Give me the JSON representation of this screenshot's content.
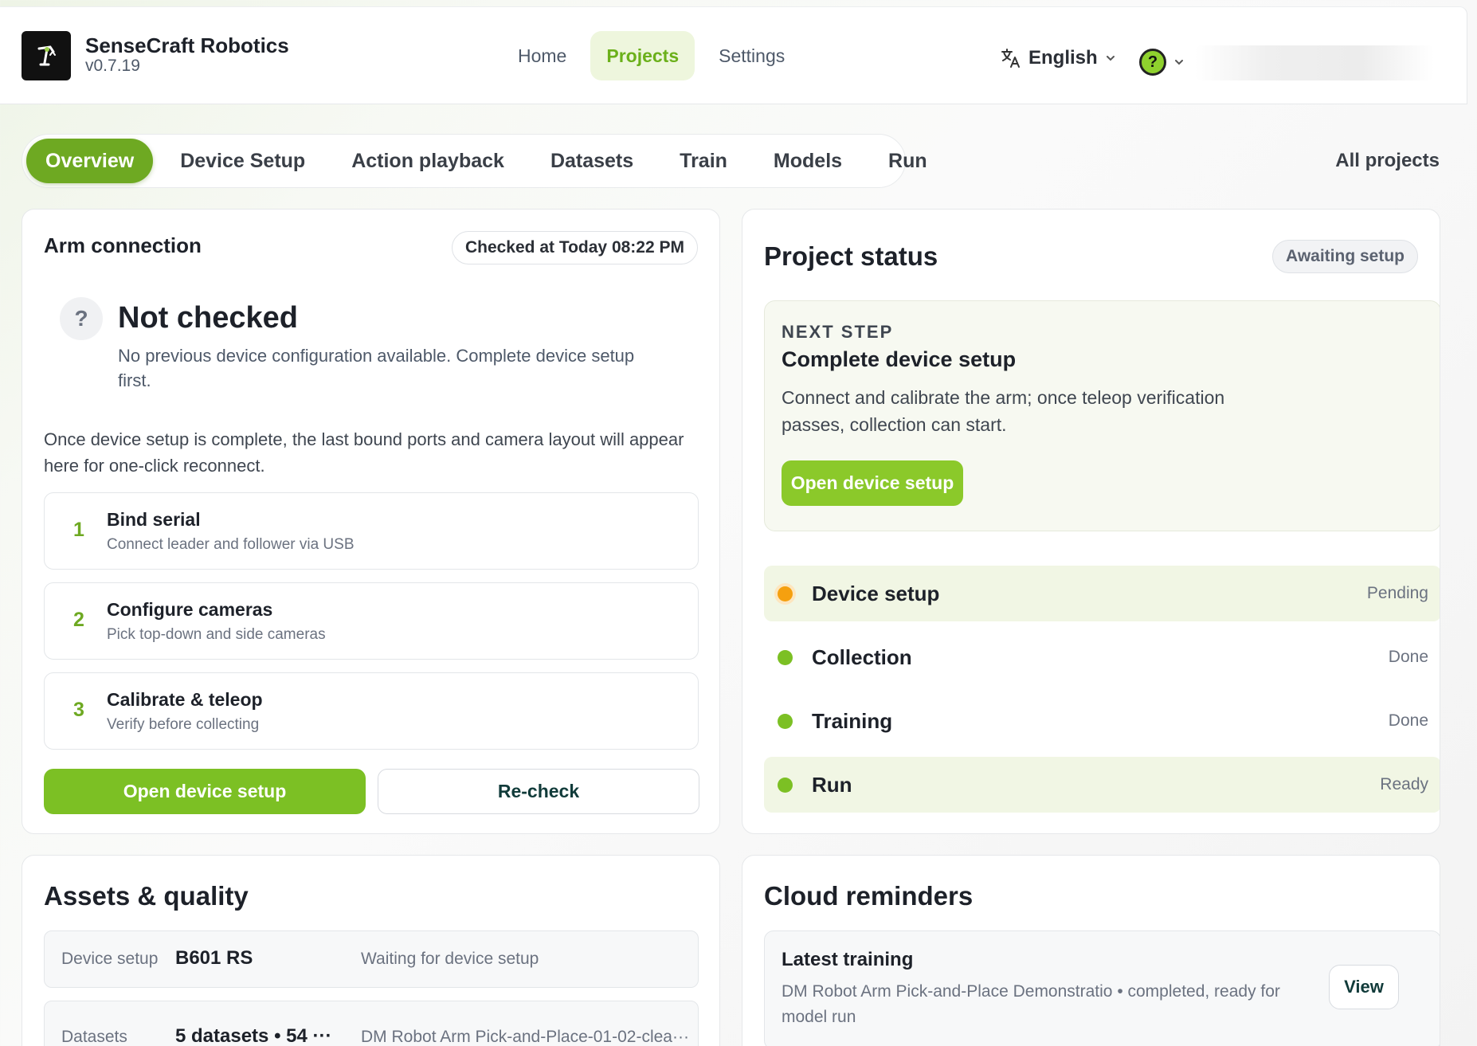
{
  "app": {
    "name": "SenseCraft Robotics",
    "version": "v0.7.19"
  },
  "nav": [
    {
      "label": "Home",
      "active": false
    },
    {
      "label": "Projects",
      "active": true
    },
    {
      "label": "Settings",
      "active": false
    }
  ],
  "language": {
    "label": "English"
  },
  "tabs": [
    {
      "label": "Overview",
      "active": true
    },
    {
      "label": "Device Setup",
      "active": false
    },
    {
      "label": "Action playback",
      "active": false
    },
    {
      "label": "Datasets",
      "active": false
    },
    {
      "label": "Train",
      "active": false
    },
    {
      "label": "Models",
      "active": false
    },
    {
      "label": "Run",
      "active": false
    }
  ],
  "all_projects": "All projects",
  "arm": {
    "title": "Arm connection",
    "checked_at": "Checked at Today 08:22 PM",
    "status": "Not checked",
    "status_desc": "No previous device configuration available. Complete device setup first.",
    "info": "Once device setup is complete, the last bound ports and camera layout will appear here for one-click reconnect.",
    "steps": [
      {
        "num": "1",
        "title": "Bind serial",
        "sub": "Connect leader and follower via USB"
      },
      {
        "num": "2",
        "title": "Configure cameras",
        "sub": "Pick top-down and side cameras"
      },
      {
        "num": "3",
        "title": "Calibrate & teleop",
        "sub": "Verify before collecting"
      }
    ],
    "primary_button": "Open device setup",
    "secondary_button": "Re-check"
  },
  "project_status": {
    "title": "Project status",
    "badge": "Awaiting setup",
    "next_kicker": "NEXT STEP",
    "next_title": "Complete device setup",
    "next_desc": "Connect and calibrate the arm; once teleop verification passes, collection can start.",
    "next_button": "Open device setup",
    "stages": [
      {
        "name": "Device setup",
        "state": "Pending",
        "dot_color": "#f5a00f",
        "highlight": true
      },
      {
        "name": "Collection",
        "state": "Done",
        "dot_color": "#7cc024",
        "highlight": false
      },
      {
        "name": "Training",
        "state": "Done",
        "dot_color": "#7cc024",
        "highlight": false
      },
      {
        "name": "Run",
        "state": "Ready",
        "dot_color": "#7cc024",
        "highlight": true
      }
    ]
  },
  "assets": {
    "title": "Assets & quality",
    "rows": [
      {
        "label": "Device setup",
        "value": "B601 RS",
        "note": "Waiting for device setup"
      },
      {
        "label": "Datasets",
        "value": "5 datasets • 54 ···",
        "note": "DM Robot Arm Pick-and-Place-01-02-clea···"
      }
    ]
  },
  "cloud": {
    "title": "Cloud reminders",
    "item_title": "Latest training",
    "item_desc": "DM Robot Arm Pick-and-Place Demonstratio • completed, ready for model run",
    "view_button": "View"
  },
  "colors": {
    "accent": "#7cc024",
    "accent_dark": "#6ea922",
    "pending": "#f5a00f"
  },
  "icons": {
    "logo": "robot-arm-logo",
    "language": "translate-icon",
    "help": "help-icon",
    "chevron": "chevron-down-icon"
  }
}
